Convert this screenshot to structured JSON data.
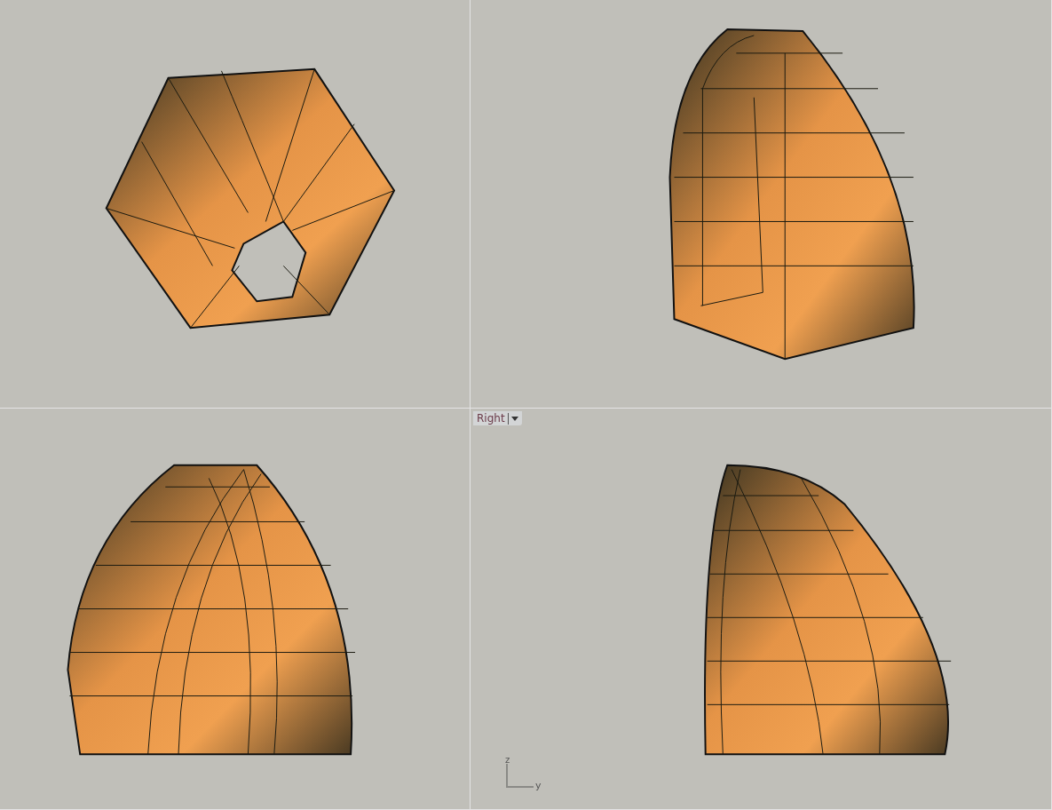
{
  "viewports": [
    {
      "kind": "plain"
    },
    {
      "kind": "plain"
    },
    {
      "kind": "plain"
    },
    {
      "kind": "labeled",
      "label": "Right",
      "axes": {
        "vertical": "z",
        "horizontal": "y"
      }
    }
  ]
}
